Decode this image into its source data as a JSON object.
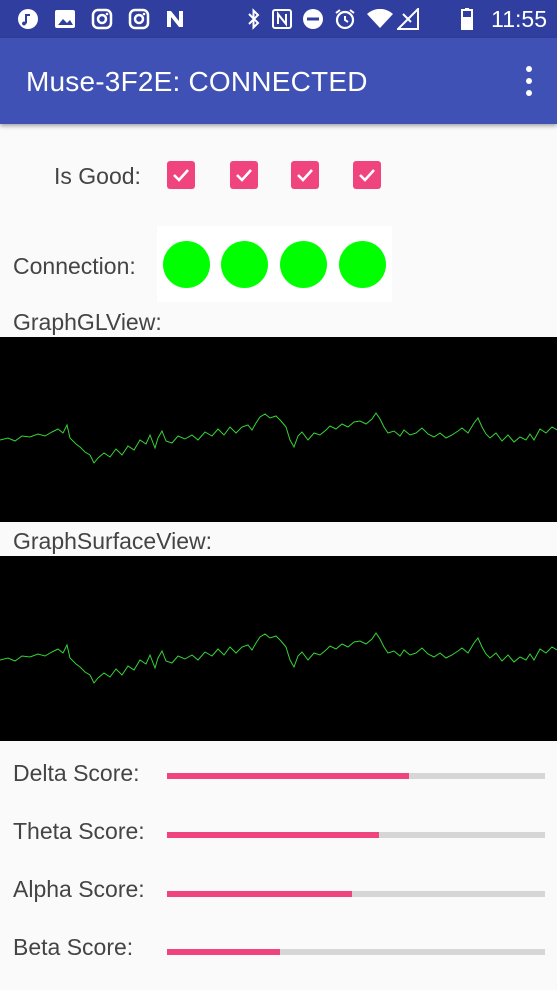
{
  "status_bar": {
    "time": "11:55",
    "left_icons": [
      "music-note-icon",
      "image-icon",
      "instagram-icon",
      "instagram-icon",
      "nfc-n-icon"
    ],
    "right_icons": [
      "bluetooth-icon",
      "nfc-icon",
      "do-not-disturb-icon",
      "alarm-icon",
      "wifi-icon",
      "cellular-no-signal-icon",
      "battery-icon"
    ]
  },
  "app_bar": {
    "title": "Muse-3F2E: CONNECTED",
    "color": "#3f51b5"
  },
  "is_good": {
    "label": "Is Good:",
    "checks": [
      true,
      true,
      true,
      true
    ]
  },
  "connection": {
    "label": "Connection:",
    "indicator_color": "#00ff00",
    "count": 4
  },
  "graph_gl": {
    "label": "GraphGLView:"
  },
  "graph_surface": {
    "label": "GraphSurfaceView:"
  },
  "scores": {
    "accent": "#f0447f",
    "items": [
      {
        "label": "Delta Score:",
        "value": 0.64
      },
      {
        "label": "Theta Score:",
        "value": 0.56
      },
      {
        "label": "Alpha Score:",
        "value": 0.49
      },
      {
        "label": "Beta Score:",
        "value": 0.3
      }
    ]
  }
}
